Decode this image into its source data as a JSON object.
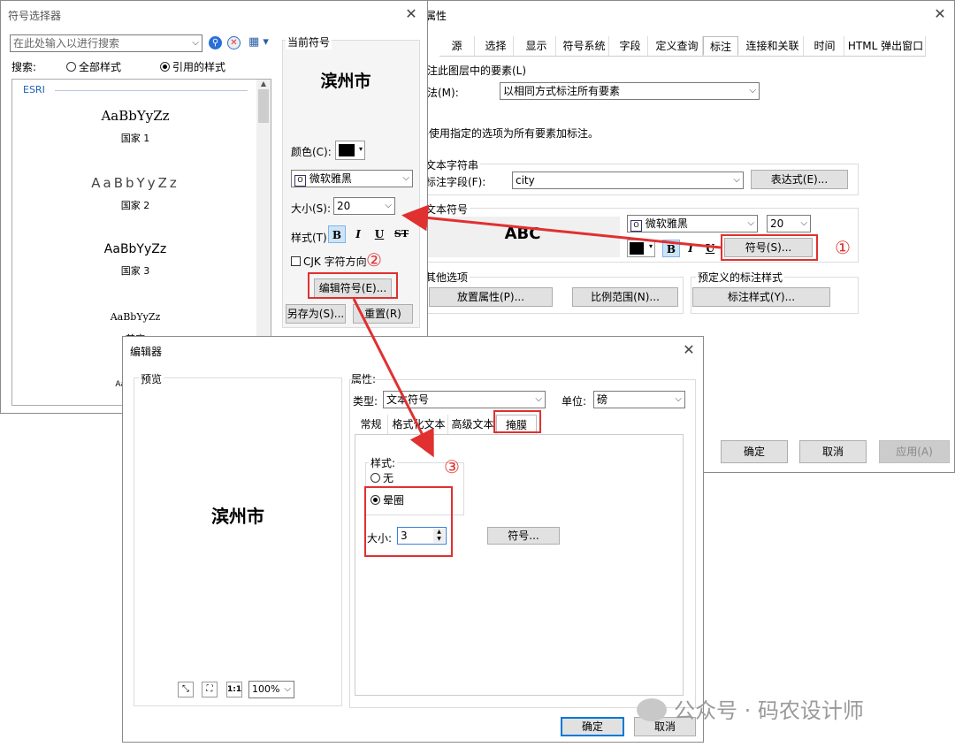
{
  "props": {
    "title": "属性",
    "tabs": [
      "源",
      "选择",
      "显示",
      "符号系统",
      "字段",
      "定义查询",
      "标注",
      "连接和关联",
      "时间",
      "HTML 弹出窗口"
    ],
    "active_tab": "标注",
    "label_check": "标注此图层中的要素(L)",
    "method_label": "方法(M):",
    "method_value": "以相同方式标注所有要素",
    "note": "将使用指定的选项为所有要素加标注。",
    "text_string_group": "文本字符串",
    "label_field_label": "标注字段(F):",
    "label_field_value": "city",
    "expression_button": "表达式(E)...",
    "text_symbol_group": "文本符号",
    "preview_text": "ABC",
    "font_value": "微软雅黑",
    "size_value": "20",
    "symbol_button": "符号(S)...",
    "other_options_group": "其他选项",
    "placement_button": "放置属性(P)...",
    "scale_button": "比例范围(N)...",
    "predefined_group": "预定义的标注样式",
    "label_styles_button": "标注样式(Y)...",
    "ok": "确定",
    "cancel": "取消",
    "apply": "应用(A)"
  },
  "selector": {
    "title": "符号选择器",
    "search_placeholder": "在此处输入以进行搜索",
    "search_label": "搜索:",
    "radio_all": "全部样式",
    "radio_ref": "引用的样式",
    "list_header": "ESRI",
    "items": [
      {
        "sample": "AaBbYyZz",
        "name": "国家 1"
      },
      {
        "sample": "AaBbYyZz",
        "name": "国家 2"
      },
      {
        "sample": "AaBbYyZz",
        "name": "国家 3"
      },
      {
        "sample": "AaBbYyZz",
        "name": "首府"
      },
      {
        "sample": "AaBbYyZz",
        "name": ""
      }
    ],
    "current_symbol_group": "当前符号",
    "current_preview": "滨州市",
    "color_label": "颜色(C):",
    "font_value": "微软雅黑",
    "size_label": "大小(S):",
    "size_value": "20",
    "style_label": "样式(T):",
    "cjk_label": "CJK 字符方向",
    "edit_symbol_button": "编辑符号(E)...",
    "save_as_button": "另存为(S)...",
    "reset_button": "重置(R)"
  },
  "editor": {
    "title": "编辑器",
    "preview_group": "预览",
    "preview_text": "滨州市",
    "zoom_value": "100%",
    "properties_group": "属性:",
    "type_label": "类型:",
    "type_value": "文本符号",
    "unit_label": "单位:",
    "unit_value": "磅",
    "tabs": [
      "常规",
      "格式化文本",
      "高级文本",
      "掩膜"
    ],
    "active_tab": "掩膜",
    "style_group": "样式:",
    "radio_none": "无",
    "radio_halo": "晕圈",
    "size_label": "大小:",
    "size_value": "3",
    "symbol_button": "符号...",
    "ok": "确定",
    "cancel": "取消"
  },
  "callouts": [
    "①",
    "②",
    "③"
  ],
  "watermark": "公众号 · 码农设计师",
  "colors": {
    "annotation": "#e03030",
    "accent": "#0078d7"
  }
}
